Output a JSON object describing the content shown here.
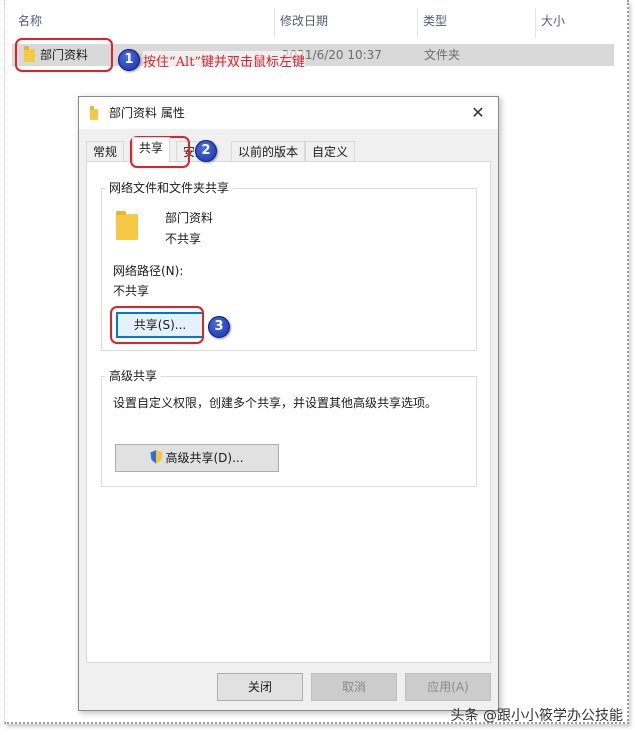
{
  "explorer": {
    "columns": [
      "名称",
      "修改日期",
      "类型",
      "大小"
    ],
    "selected_row": {
      "name": "部门资料",
      "modified": "2021/6/20 10:37",
      "type": "文件夹"
    }
  },
  "annotations": {
    "step1_number": "1",
    "step1_text": "按住“Alt”键并双击鼠标左键",
    "step2_number": "2",
    "step3_number": "3"
  },
  "dialog": {
    "title": "部门资料 属性",
    "close_glyph": "✕",
    "tabs": [
      "常规",
      "共享",
      "安全",
      "以前的版本",
      "自定义"
    ],
    "active_tab": "共享",
    "network_share": {
      "group_title": "网络文件和文件夹共享",
      "folder_name": "部门资料",
      "status": "不共享",
      "path_label": "网络路径(N):",
      "path_value": "不共享",
      "share_button": "共享(S)..."
    },
    "advanced_share": {
      "group_title": "高级共享",
      "description": "设置自定义权限，创建多个共享，并设置其他高级共享选项。",
      "button": "高级共享(D)..."
    },
    "footer": {
      "close": "关闭",
      "cancel": "取消",
      "apply": "应用(A)"
    }
  },
  "watermark": "头条 @跟小小筱学办公技能",
  "icons": [
    "folder-icon",
    "close-icon",
    "shield-icon"
  ],
  "colors": {
    "annotation_red": "#e2212a",
    "badge_blue": "#1a2fa8",
    "focus_blue": "#0078d7",
    "folder_yellow": "#f6c846"
  }
}
